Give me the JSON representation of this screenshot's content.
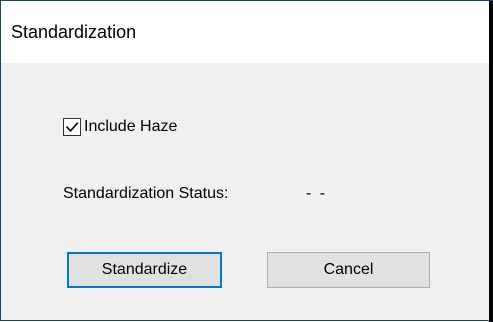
{
  "window": {
    "title": "Standardization"
  },
  "options": {
    "include_haze_label": "Include Haze",
    "include_haze_checked": true
  },
  "status": {
    "label": "Standardization Status:",
    "value": "- -"
  },
  "buttons": {
    "standardize_label": "Standardize",
    "cancel_label": "Cancel"
  },
  "colors": {
    "title_bg": "#ffffff",
    "dialog_bg": "#f0f0f0",
    "button_bg": "#e1e1e1",
    "button_border": "#adadad",
    "focus_accent": "#0078d7",
    "window_border": "#1b3f73"
  },
  "icons": {
    "checkbox_mark": "checkmark-icon"
  }
}
